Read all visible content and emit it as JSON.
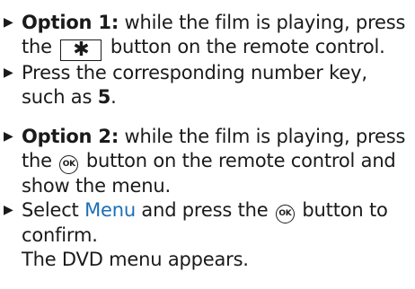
{
  "items": [
    {
      "bullet_glyph": "▶",
      "option_label": "Option 1:",
      "text_before": "while the film is playing, press the",
      "key_glyph": "✱",
      "text_after": "button on the remote control."
    },
    {
      "bullet_glyph": "▶",
      "text_before": "Press the corresponding number key, such as",
      "number": "5",
      "text_after": "."
    },
    {
      "bullet_glyph": "▶",
      "option_label": "Option 2:",
      "text_before": "while the film is playing, press the",
      "button_label": "OK",
      "text_after": "button on the remote control and show the menu."
    },
    {
      "bullet_glyph": "▶",
      "text_before": "Select",
      "menu_label": "Menu",
      "text_mid": "and press the",
      "button_label": "OK",
      "text_after": "button to confirm.",
      "result": "The DVD menu appears."
    }
  ],
  "colors": {
    "text": "#1a1a1a",
    "menu_highlight": "#1c6fb8"
  }
}
